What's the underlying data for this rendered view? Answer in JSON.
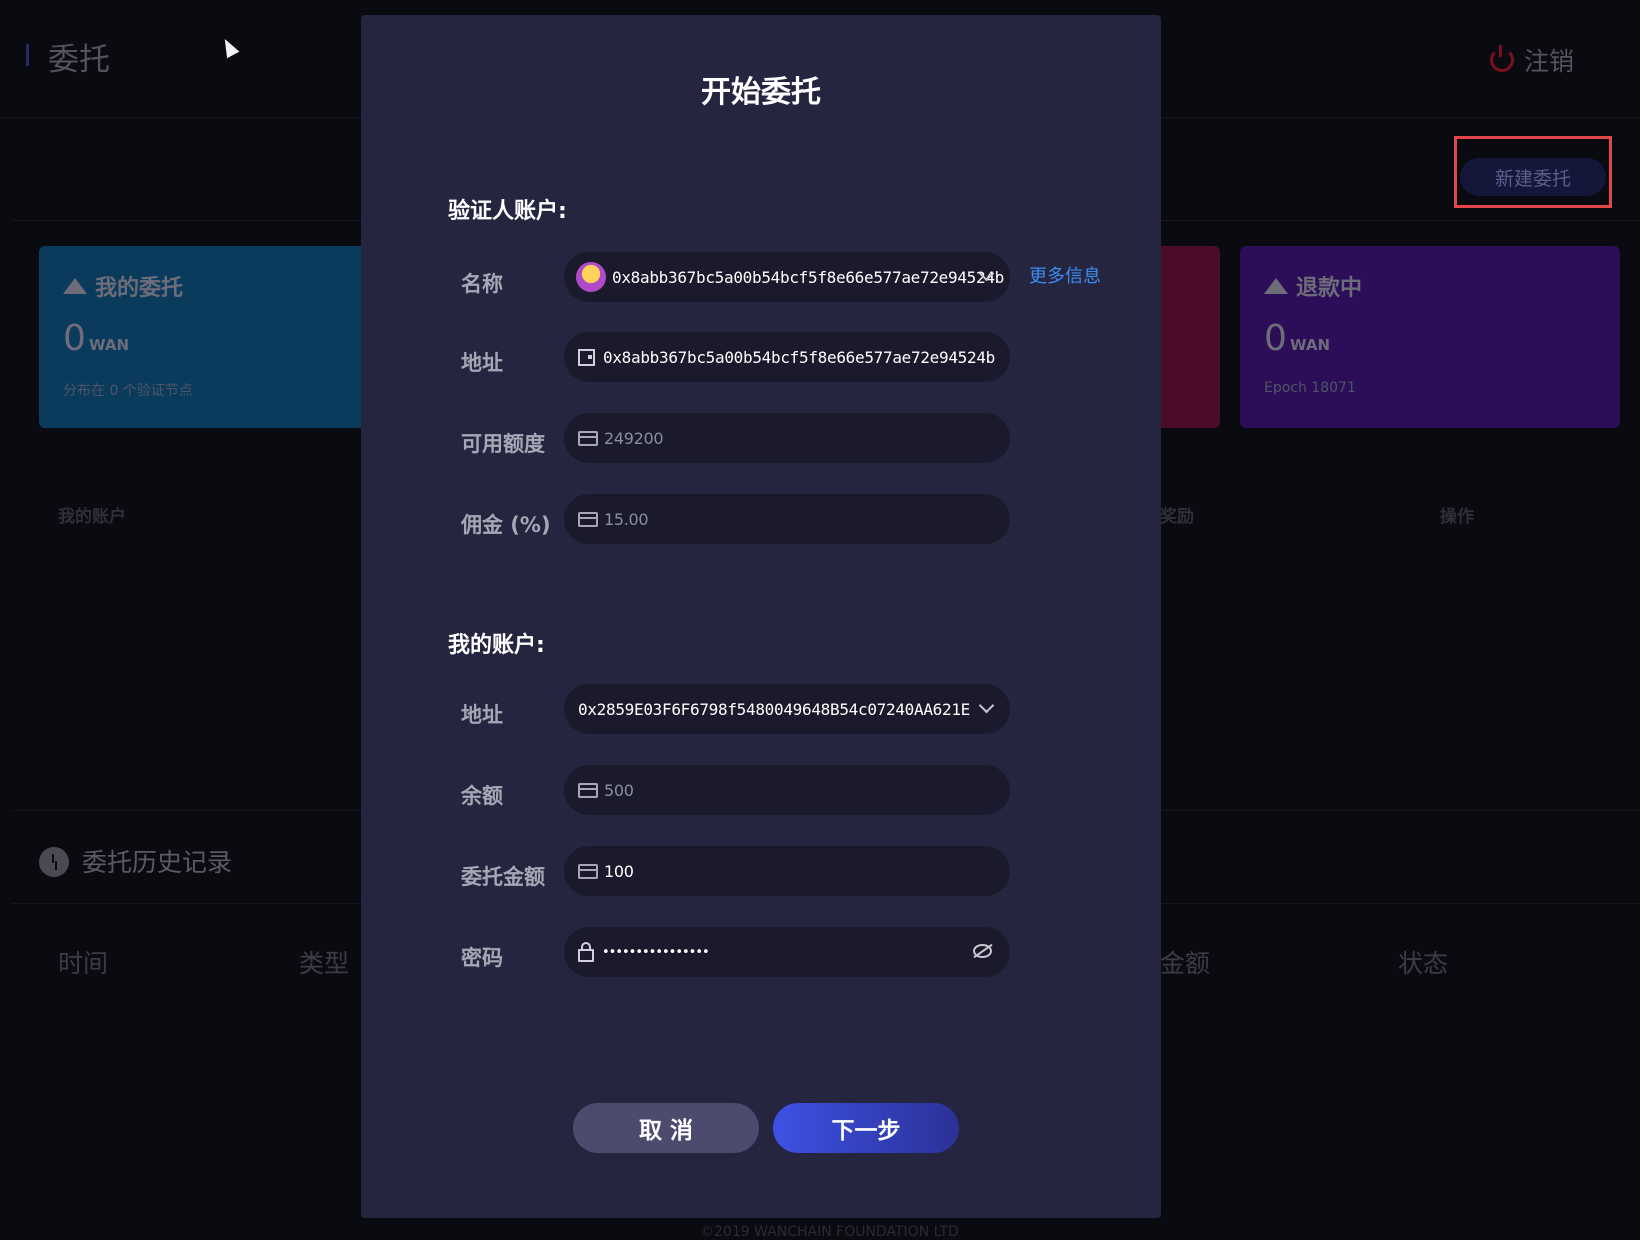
{
  "header": {
    "title": "委托",
    "logout_label": "注销"
  },
  "toolbar": {
    "new_delegation_label": "新建委托"
  },
  "cards": [
    {
      "title": "我的委托",
      "amount": "0",
      "unit": "WAN",
      "sub": "分布在 0 个验证节点",
      "color": "#0a3a5c"
    },
    {
      "title": "退款中",
      "amount": "0",
      "unit": "WAN",
      "sub": "Epoch 18071",
      "color": "#2c0e58"
    }
  ],
  "table": {
    "col_account": "我的账户",
    "col_reward": "奖励",
    "col_action": "操作"
  },
  "history": {
    "title": "委托历史记录",
    "columns": [
      "时间",
      "类型",
      "金额",
      "状态"
    ]
  },
  "footer": "©2019 WANCHAIN FOUNDATION LTD",
  "modal": {
    "title": "开始委托",
    "validator_section": "验证人账户:",
    "name_label": "名称",
    "name_value": "0x8abb367bc5a00b54bcf5f8e66e577ae72e94524b",
    "more_info": "更多信息",
    "address_label": "地址",
    "address_value": "0x8abb367bc5a00b54bcf5f8e66e577ae72e94524b",
    "quota_label": "可用额度",
    "quota_value": "249200",
    "commission_label": "佣金 (%)",
    "commission_value": "15.00",
    "my_section": "我的账户:",
    "my_address_label": "地址",
    "my_address_value": "0x2859E03F6F6798f5480049648B54c07240AA621E",
    "balance_label": "余额",
    "balance_value": "500",
    "amount_label": "委托金额",
    "amount_value": "100",
    "password_label": "密码",
    "password_value": "••••••••••••••••",
    "cancel_label": "取 消",
    "next_label": "下一步"
  },
  "colors": {
    "modal_bg": "#262540",
    "accent": "#3e52e4",
    "link": "#3d8cf0"
  }
}
